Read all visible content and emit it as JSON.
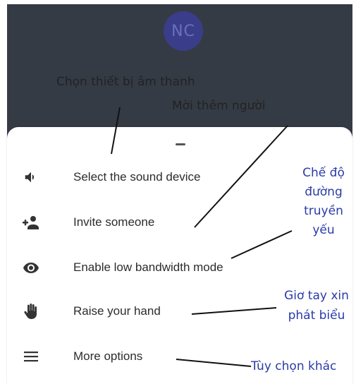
{
  "call": {
    "avatar_initials": "NC"
  },
  "menu": {
    "items": [
      {
        "label": "Select the sound device",
        "icon": "speaker-icon"
      },
      {
        "label": "Invite someone",
        "icon": "add-person-icon"
      },
      {
        "label": "Enable low bandwidth mode",
        "icon": "eye-icon"
      },
      {
        "label": "Raise your hand",
        "icon": "hand-icon"
      },
      {
        "label": "More options",
        "icon": "menu-icon"
      }
    ]
  },
  "annotations": {
    "sound_device": "Chọn thiết bị âm thanh",
    "invite": "Mời thêm người",
    "low_bandwidth_1": "Chế độ",
    "low_bandwidth_2": "đường",
    "low_bandwidth_3": "truyền",
    "low_bandwidth_4": "yếu",
    "raise_hand_1": "Giơ tay xin",
    "raise_hand_2": "phát biểu",
    "more_options": "Tùy chọn khác"
  },
  "colors": {
    "dark_background": "#353b45",
    "annotation_blue": "#2a3ba8",
    "annotation_dark": "#222222"
  }
}
